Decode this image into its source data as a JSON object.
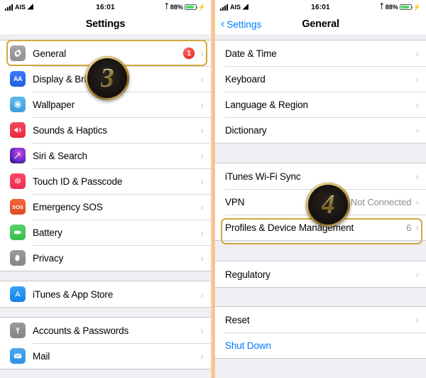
{
  "statusbar": {
    "carrier": "AIS",
    "time": "16:01",
    "battery_percent": "88%",
    "signal_icon": "signal-bars-icon",
    "wifi_icon": "wifi-icon",
    "bluetooth_icon": "bluetooth-icon",
    "battery_icon": "battery-icon",
    "charging_icon": "charging-bolt-icon"
  },
  "left_phone": {
    "nav_title": "Settings",
    "groups": [
      {
        "rows": [
          {
            "label": "General",
            "icon": "gear-icon",
            "badge": "1",
            "accessory": "chevron-right-icon",
            "highlight": true
          },
          {
            "label": "Display & Brightness",
            "icon": "display-brightness-icon",
            "accessory": "chevron-right-icon"
          },
          {
            "label": "Wallpaper",
            "icon": "wallpaper-icon",
            "accessory": "chevron-right-icon"
          },
          {
            "label": "Sounds & Haptics",
            "icon": "sounds-haptics-icon",
            "accessory": "chevron-right-icon"
          },
          {
            "label": "Siri & Search",
            "icon": "siri-search-icon",
            "accessory": "chevron-right-icon"
          },
          {
            "label": "Touch ID & Passcode",
            "icon": "touch-id-icon",
            "accessory": "chevron-right-icon"
          },
          {
            "label": "Emergency SOS",
            "icon": "emergency-sos-icon",
            "accessory": "chevron-right-icon"
          },
          {
            "label": "Battery",
            "icon": "battery-settings-icon",
            "accessory": "chevron-right-icon"
          },
          {
            "label": "Privacy",
            "icon": "privacy-hand-icon",
            "accessory": "chevron-right-icon"
          }
        ]
      },
      {
        "rows": [
          {
            "label": "iTunes & App Store",
            "icon": "app-store-icon",
            "accessory": "chevron-right-icon"
          }
        ]
      },
      {
        "rows": [
          {
            "label": "Accounts & Passwords",
            "icon": "key-icon",
            "accessory": "chevron-right-icon"
          },
          {
            "label": "Mail",
            "icon": "mail-icon",
            "accessory": "chevron-right-icon"
          }
        ]
      }
    ],
    "step_badge": "3"
  },
  "right_phone": {
    "nav_back_label": "Settings",
    "nav_title": "General",
    "groups": [
      {
        "rows": [
          {
            "label": "Date & Time",
            "accessory": "chevron-right-icon"
          },
          {
            "label": "Keyboard",
            "accessory": "chevron-right-icon"
          },
          {
            "label": "Language & Region",
            "accessory": "chevron-right-icon"
          },
          {
            "label": "Dictionary",
            "accessory": "chevron-right-icon"
          }
        ]
      },
      {
        "rows": [
          {
            "label": "iTunes Wi-Fi Sync",
            "accessory": "chevron-right-icon"
          },
          {
            "label": "VPN",
            "value": "Not Connected",
            "accessory": "chevron-right-icon"
          },
          {
            "label": "Profiles & Device Management",
            "value": "6",
            "accessory": "chevron-right-icon",
            "highlight": true
          }
        ]
      },
      {
        "rows": [
          {
            "label": "Regulatory",
            "accessory": "chevron-right-icon"
          }
        ]
      },
      {
        "rows": [
          {
            "label": "Reset",
            "accessory": "chevron-right-icon"
          },
          {
            "label": "Shut Down",
            "link": true
          }
        ]
      }
    ],
    "step_badge": "4"
  },
  "colors": {
    "accent_blue": "#007aff",
    "badge_red": "#e8352b",
    "highlight_gold": "#cfa83c",
    "divider_peach": "#f4b980",
    "group_background": "#efeff4"
  }
}
